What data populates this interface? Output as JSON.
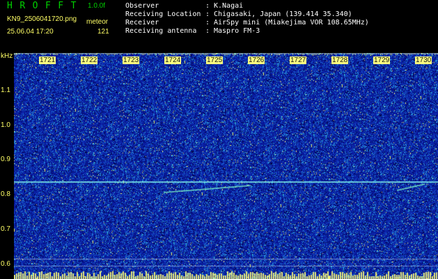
{
  "header": {
    "app_title": "HROFFT",
    "version": "1.0.0f",
    "file_name": "KN9_2506041720.png",
    "mode": "meteor",
    "datetime": "25.06.04 17:20",
    "count": "121"
  },
  "meta": [
    {
      "key": "Observer",
      "sep": ":",
      "value": "K.Nagai"
    },
    {
      "key": "Receiving Location",
      "sep": ":",
      "value": "Chigasaki, Japan (139.414 35.340)"
    },
    {
      "key": "Receiver",
      "sep": ":",
      "value": "AirSpy mini (Miakejima VOR 108.65MHz)"
    },
    {
      "key": "Receiving antenna",
      "sep": ":",
      "value": "Maspro FM-3"
    }
  ],
  "axis": {
    "unit": "kHz",
    "y_ticks": [
      "1.1",
      "1.0",
      "0.9",
      "0.8",
      "0.7",
      "0.6"
    ],
    "x_ticks": [
      "1721",
      "1722",
      "1723",
      "1724",
      "1725",
      "1726",
      "1727",
      "1728",
      "1729",
      "1730"
    ]
  },
  "colors": {
    "background": "#000000",
    "title": "#00d000",
    "label": "#ffff66",
    "meta_text": "#ffffff",
    "spectrogram_base": "#0a1a9c",
    "signal_line": "#ffffaa"
  }
}
